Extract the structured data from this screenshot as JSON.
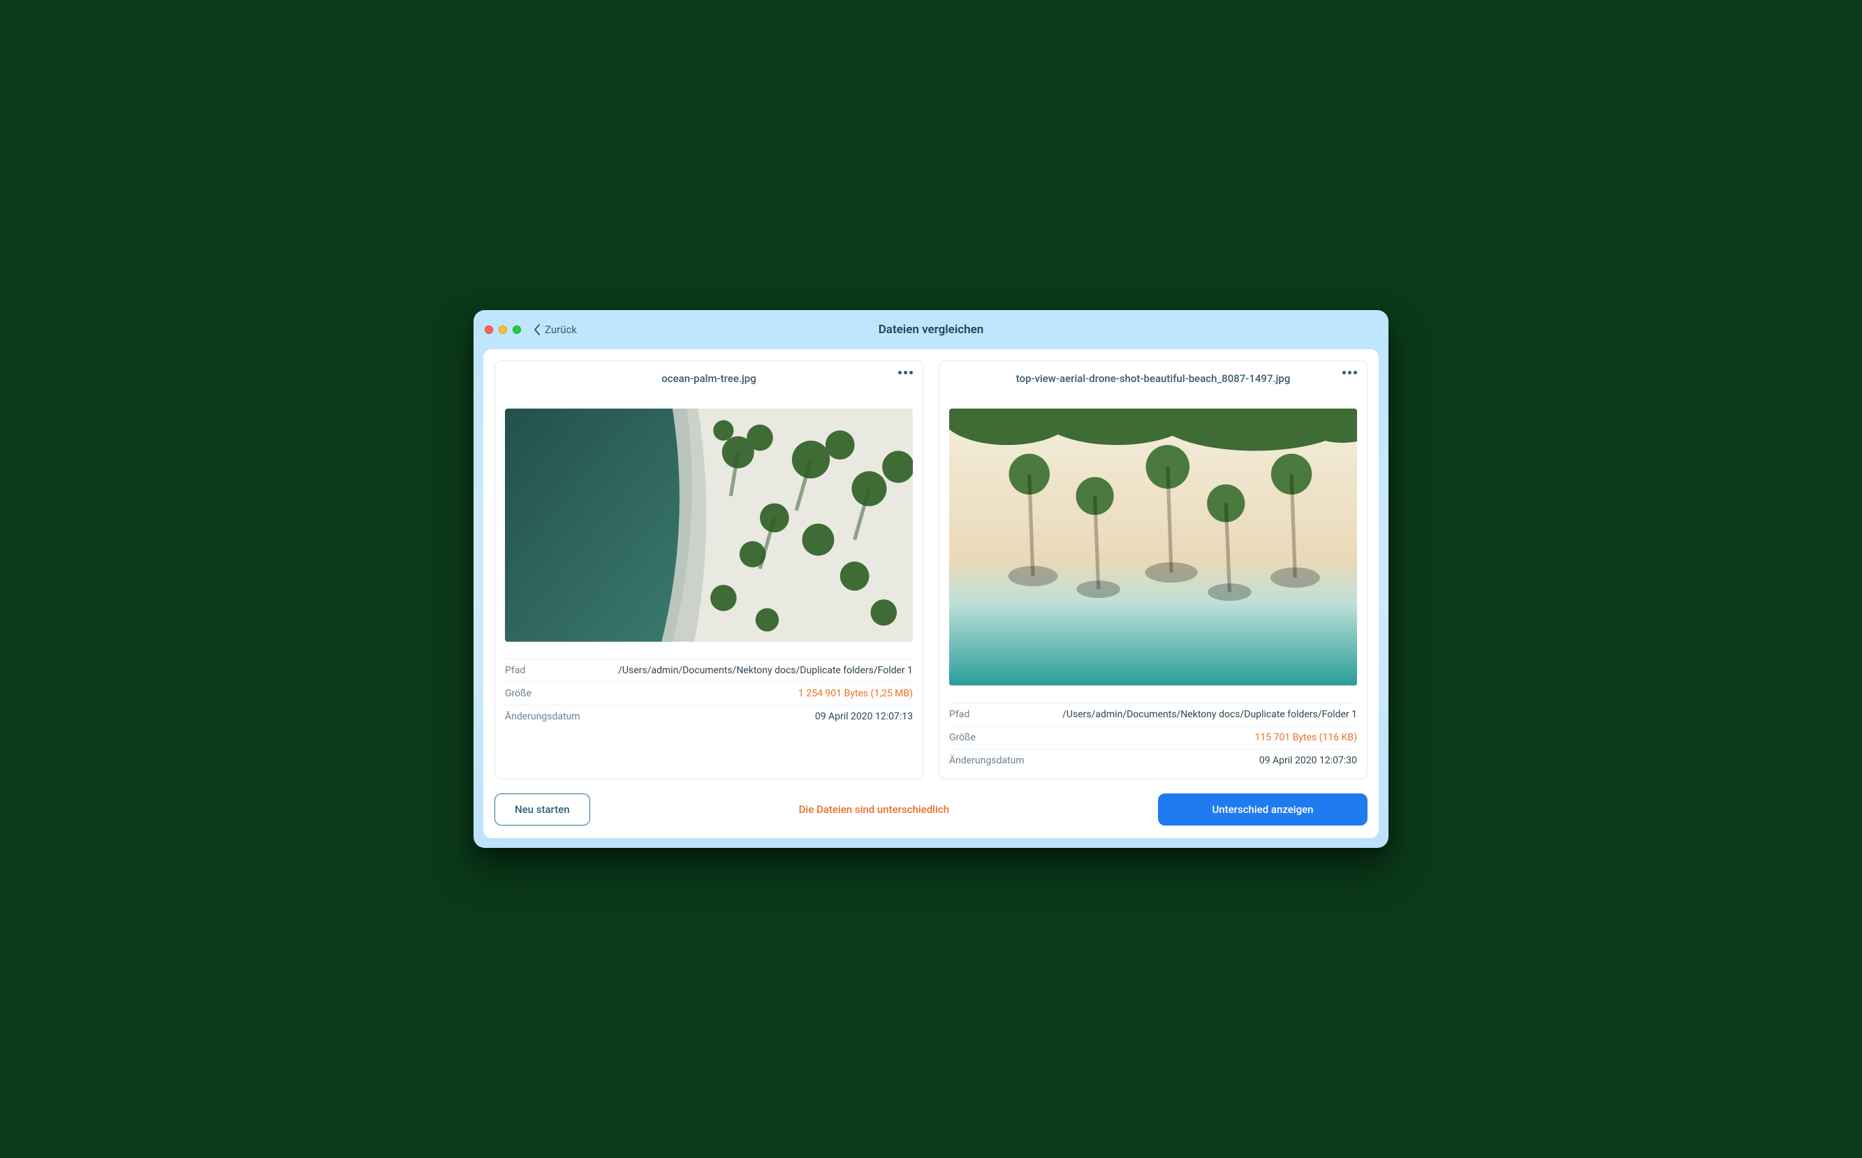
{
  "window": {
    "title": "Dateien vergleichen",
    "back_label": "Zurück"
  },
  "labels": {
    "path": "Pfad",
    "size": "Größe",
    "modified": "Änderungsdatum"
  },
  "files": [
    {
      "name": "ocean-palm-tree.jpg",
      "path": "/Users/admin/Documents/Nektony docs/Duplicate folders/Folder 1",
      "size": "1 254 901 Bytes (1,25 MB)",
      "modified": "09 April 2020 12:07:13"
    },
    {
      "name": "top-view-aerial-drone-shot-beautiful-beach_8087-1497.jpg",
      "path": "/Users/admin/Documents/Nektony docs/Duplicate folders/Folder 1",
      "size": "115 701 Bytes (116 KB)",
      "modified": "09 April 2020 12:07:30"
    }
  ],
  "footer": {
    "restart": "Neu starten",
    "status": "Die Dateien sind unterschiedlich",
    "show_diff": "Unterschied anzeigen"
  }
}
